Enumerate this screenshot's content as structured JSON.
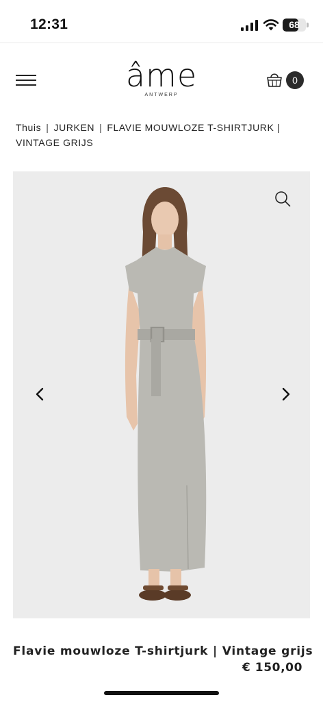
{
  "status_bar": {
    "time": "12:31",
    "battery_level": "68",
    "battery_fraction": 0.68
  },
  "header": {
    "logo_text": "âme",
    "logo_subtext": "ANTWERP",
    "cart_count": "0"
  },
  "breadcrumb": {
    "items": [
      "Thuis",
      "JURKEN",
      "FLAVIE MOUWLOZE T-SHIRTJURK | VINTAGE GRIJS"
    ],
    "separator": "|"
  },
  "gallery": {
    "background_color": "#ececec",
    "dress_color": "#b9b8b3",
    "icons": [
      "zoom-icon",
      "chevron-left-icon",
      "chevron-right-icon"
    ]
  },
  "product": {
    "title": "Flavie mouwloze T-shirtjurk | Vintage grijs",
    "price": "€ 150,00"
  }
}
